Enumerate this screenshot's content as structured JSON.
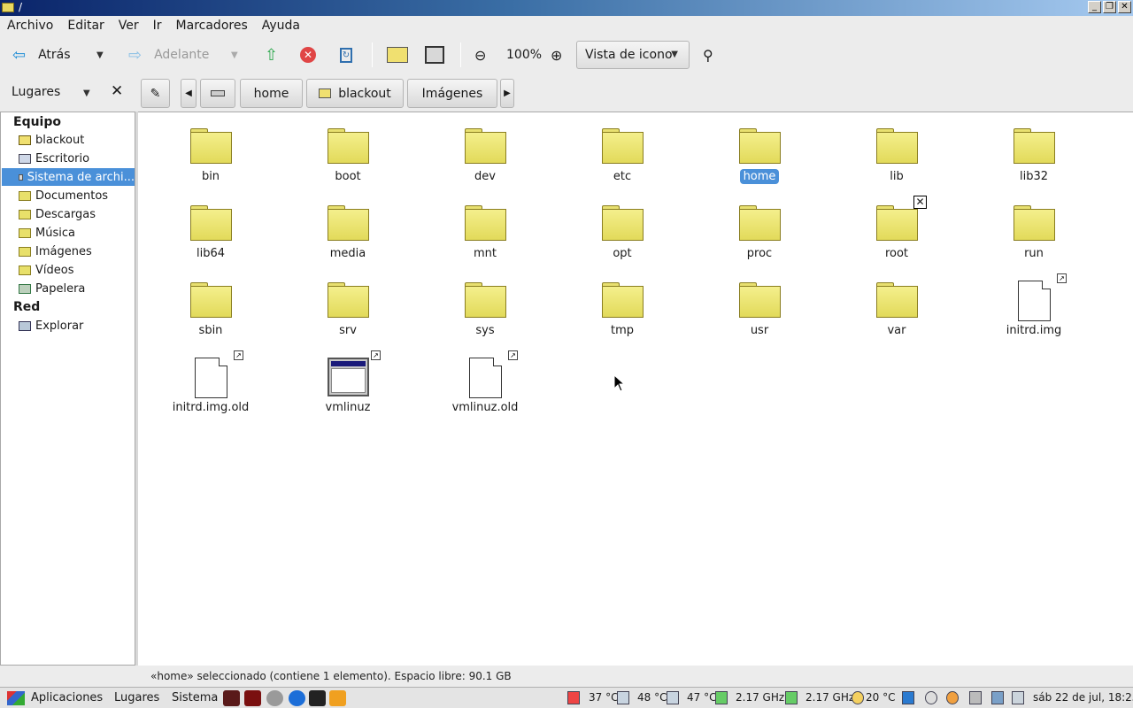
{
  "window": {
    "title": "/",
    "buttons": {
      "minimize": "_",
      "maximize": "❐",
      "close": "✕"
    }
  },
  "menubar": {
    "items": [
      "Archivo",
      "Editar",
      "Ver",
      "Ir",
      "Marcadores",
      "Ayuda"
    ]
  },
  "toolbar": {
    "back_label": "Atrás",
    "forward_label": "Adelante",
    "zoom_level": "100%",
    "view_mode": "Vista de icono"
  },
  "places_bar": {
    "label": "Lugares"
  },
  "breadcrumb": {
    "items": [
      "home",
      "blackout",
      "Imágenes"
    ]
  },
  "sidebar": {
    "computer_heading": "Equipo",
    "computer_items": [
      {
        "label": "blackout",
        "icon": "home-icon"
      },
      {
        "label": "Escritorio",
        "icon": "desktop-icon"
      },
      {
        "label": "Sistema de archi...",
        "icon": "drive-icon",
        "selected": true
      },
      {
        "label": "Documentos",
        "icon": "folder-icon"
      },
      {
        "label": "Descargas",
        "icon": "folder-icon"
      },
      {
        "label": "Música",
        "icon": "folder-icon"
      },
      {
        "label": "Imágenes",
        "icon": "folder-icon"
      },
      {
        "label": "Vídeos",
        "icon": "folder-icon"
      },
      {
        "label": "Papelera",
        "icon": "trash-icon"
      }
    ],
    "network_heading": "Red",
    "network_items": [
      {
        "label": "Explorar",
        "icon": "network-icon"
      }
    ]
  },
  "files": [
    {
      "name": "bin",
      "type": "folder"
    },
    {
      "name": "boot",
      "type": "folder"
    },
    {
      "name": "dev",
      "type": "folder"
    },
    {
      "name": "etc",
      "type": "folder"
    },
    {
      "name": "home",
      "type": "folder",
      "selected": true
    },
    {
      "name": "lib",
      "type": "folder"
    },
    {
      "name": "lib32",
      "type": "folder"
    },
    {
      "name": "lib64",
      "type": "folder"
    },
    {
      "name": "media",
      "type": "folder"
    },
    {
      "name": "mnt",
      "type": "folder"
    },
    {
      "name": "opt",
      "type": "folder"
    },
    {
      "name": "proc",
      "type": "folder"
    },
    {
      "name": "root",
      "type": "folder",
      "no_access": true
    },
    {
      "name": "run",
      "type": "folder"
    },
    {
      "name": "sbin",
      "type": "folder"
    },
    {
      "name": "srv",
      "type": "folder"
    },
    {
      "name": "sys",
      "type": "folder"
    },
    {
      "name": "tmp",
      "type": "folder"
    },
    {
      "name": "usr",
      "type": "folder"
    },
    {
      "name": "var",
      "type": "folder"
    },
    {
      "name": "initrd.img",
      "type": "file-link"
    },
    {
      "name": "initrd.img.old",
      "type": "file-link"
    },
    {
      "name": "vmlinuz",
      "type": "exe-link"
    },
    {
      "name": "vmlinuz.old",
      "type": "file-link"
    }
  ],
  "status": {
    "text": "«home» seleccionado (contiene 1 elemento). Espacio libre: 90.1 GB"
  },
  "panel": {
    "menus": [
      "Aplicaciones",
      "Lugares",
      "Sistema"
    ],
    "sensors": [
      "37 °C",
      "48 °C",
      "47 °C",
      "2.17 GHz",
      "2.17 GHz",
      "20 °C"
    ],
    "clock": "sáb 22 de jul, 18:25"
  }
}
